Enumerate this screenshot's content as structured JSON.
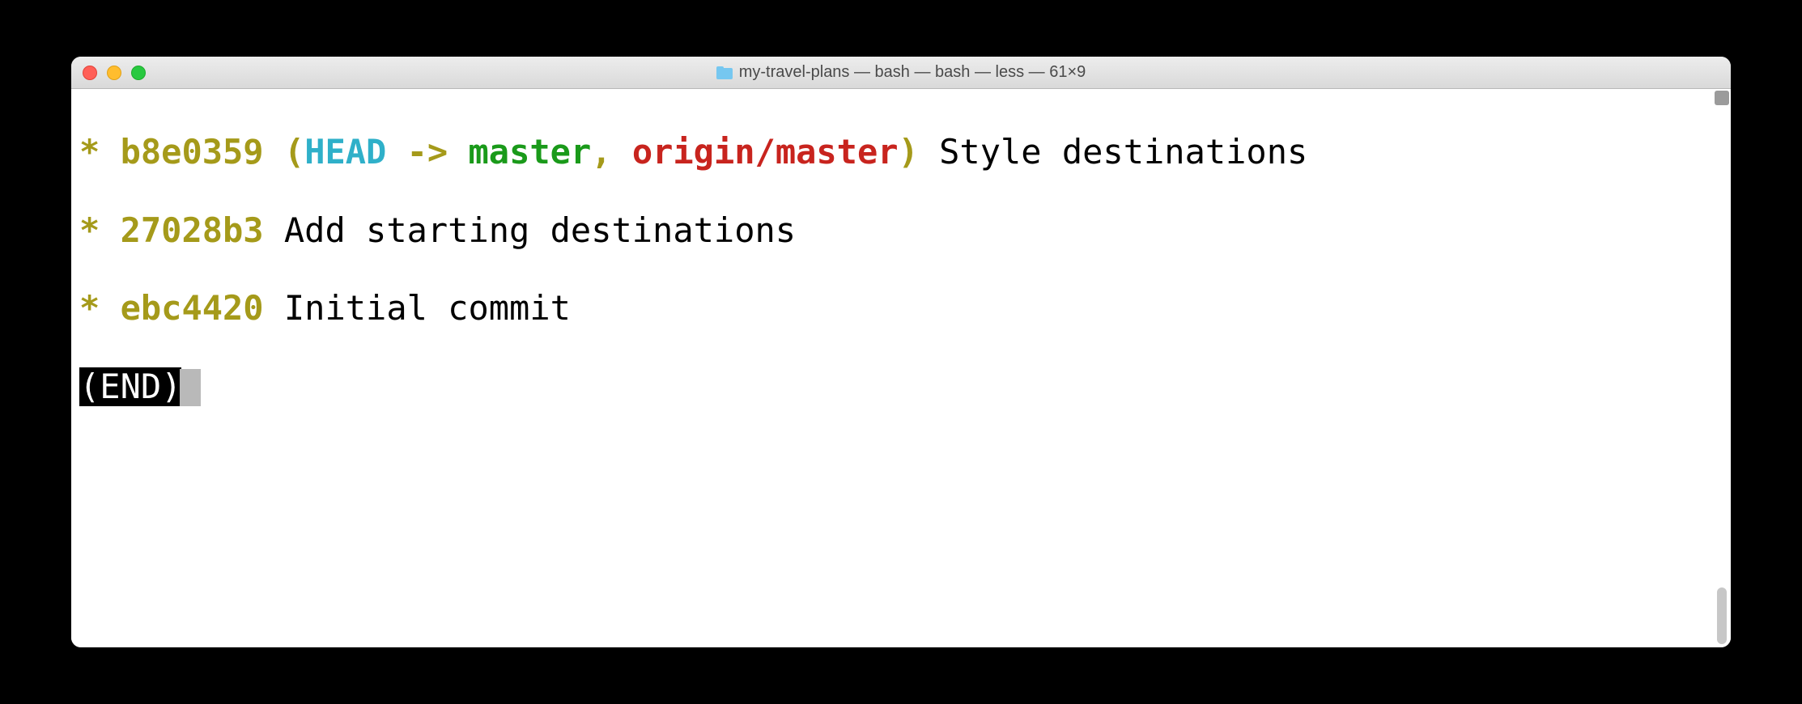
{
  "window": {
    "title": "my-travel-plans — bash — bash — less — 61×9"
  },
  "log": {
    "lines": [
      {
        "graph": "*",
        "hash": "b8e0359",
        "refs": {
          "open": "(",
          "head": "HEAD",
          "arrow": " -> ",
          "local": "master",
          "sep": ", ",
          "remote": "origin/master",
          "close": ")"
        },
        "message": " Style destinations"
      },
      {
        "graph": "*",
        "hash": "27028b3",
        "message": " Add starting destinations"
      },
      {
        "graph": "*",
        "hash": "ebc4420",
        "message": " Initial commit"
      }
    ],
    "end_marker": "(END)"
  }
}
